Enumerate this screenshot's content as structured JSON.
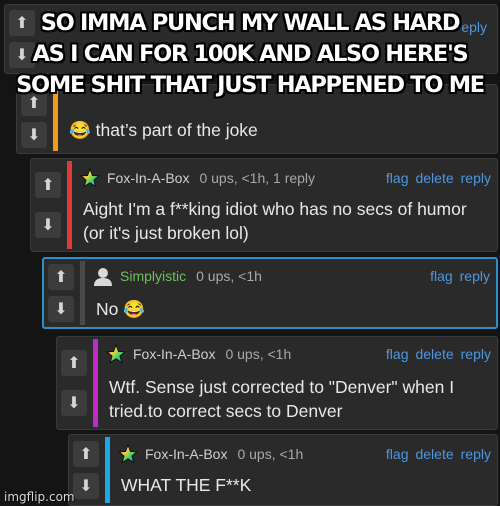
{
  "caption": {
    "lines": [
      "SO IMMA PUNCH MY WALL AS HARD",
      "AS I CAN FOR 100K AND ALSO HERE'S",
      "SOME SHIT THAT JUST HAPPENED TO ME"
    ]
  },
  "watermark": "imgflip.com",
  "colors": {
    "orange_bar": "#f39a1e",
    "red_bar": "#e03a3a",
    "magenta_bar": "#c22ac6",
    "cyan_bar": "#1ea7e6",
    "link_blue": "#4f97e0",
    "username_green": "#6ec05a"
  },
  "comments": [
    {
      "header_partial": "eply",
      "text": "😂 that’s part of the joke"
    },
    {
      "avatar_icon": "rainbow-star-icon",
      "username": "Fox-In-A-Box",
      "meta": "0 ups, <1h, 1 reply",
      "flag": "flag",
      "delete": "delete",
      "reply": "reply",
      "text": "Aight I'm a f**king idiot who has no secs of humor (or it's just broken lol)"
    },
    {
      "avatar_icon": "user-silhouette-icon",
      "username": "Simplyistic",
      "meta": "0 ups, <1h",
      "flag": "flag",
      "reply": "reply",
      "text": "No 😂"
    },
    {
      "avatar_icon": "rainbow-star-icon",
      "username": "Fox-In-A-Box",
      "meta": "0 ups, <1h",
      "flag": "flag",
      "delete": "delete",
      "reply": "reply",
      "text": "Wtf. Sense just corrected to \"Denver\" when I tried.to correct secs to Denver"
    },
    {
      "avatar_icon": "rainbow-star-icon",
      "username": "Fox-In-A-Box",
      "meta": "0 ups, <1h",
      "flag": "flag",
      "delete": "delete",
      "reply": "reply",
      "text": "WHAT THE F**K"
    }
  ]
}
